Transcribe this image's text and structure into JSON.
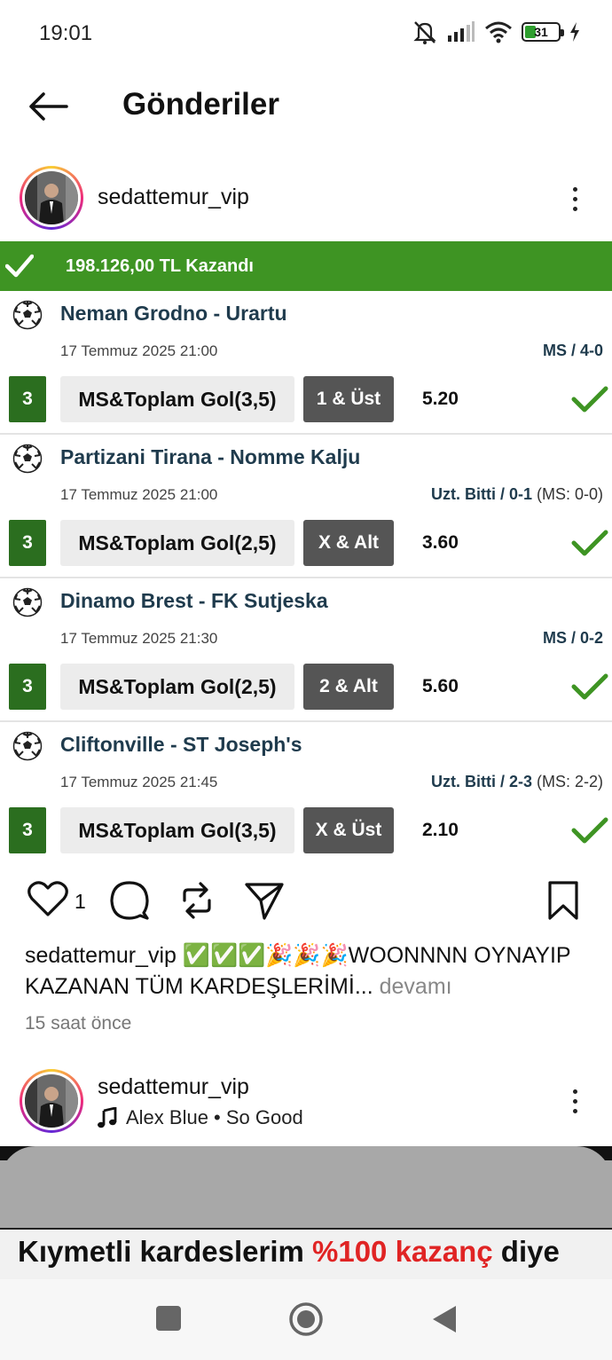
{
  "status_bar": {
    "time": "19:01",
    "battery": "31",
    "icons": [
      "mute-icon",
      "signal-icon",
      "wifi-icon",
      "battery-icon",
      "charging-icon"
    ]
  },
  "header": {
    "title": "Gönderiler",
    "back_icon": "arrow-left-icon"
  },
  "post": {
    "username": "sedattemur_vip",
    "coupon": {
      "win_text": "198.126,00 TL Kazandı",
      "matches": [
        {
          "teams": "Neman Grodno - Urartu",
          "date": "17 Temmuz 2025 21:00",
          "result_label": "MS / 4-0",
          "result_extra": "",
          "mbs": "3",
          "market": "MS&Toplam Gol(3,5)",
          "pick": "1 & Üst",
          "odd": "5.20"
        },
        {
          "teams": "Partizani Tirana - Nomme Kalju",
          "date": "17 Temmuz 2025 21:00",
          "result_label": "Uzt. Bitti / 0-1",
          "result_extra": " (MS: 0-0)",
          "mbs": "3",
          "market": "MS&Toplam Gol(2,5)",
          "pick": "X & Alt",
          "odd": "3.60"
        },
        {
          "teams": "Dinamo Brest - FK Sutjeska",
          "date": "17 Temmuz 2025 21:30",
          "result_label": "MS / 0-2",
          "result_extra": "",
          "mbs": "3",
          "market": "MS&Toplam Gol(2,5)",
          "pick": "2 & Alt",
          "odd": "5.60"
        },
        {
          "teams": "Cliftonville - ST Joseph's",
          "date": "17 Temmuz 2025 21:45",
          "result_label": "Uzt. Bitti / 2-3",
          "result_extra": " (MS: 2-2)",
          "mbs": "3",
          "market": "MS&Toplam Gol(3,5)",
          "pick": "X & Üst",
          "odd": "2.10"
        }
      ]
    },
    "like_count": "1",
    "caption_user": "sedattemur_vip",
    "caption_text": "✅✅✅🎉🎉🎉WOONNNN OYNAYIP KAZANAN TÜM KARDEŞLERİMİ...",
    "caption_more": " devamı",
    "timestamp": "15 saat önce"
  },
  "post2": {
    "username": "sedattemur_vip",
    "music": "Alex Blue • So Good",
    "media_text_a": "Kıymetli kardeslerim ",
    "media_text_accent": "%100 kazanç",
    "media_text_b": " diye"
  },
  "colors": {
    "win_green": "#3e9423",
    "mbs_green": "#2b6e1f",
    "team_text": "#1f3b4d",
    "pick_bg": "#555555",
    "accent_red": "#e02424"
  }
}
